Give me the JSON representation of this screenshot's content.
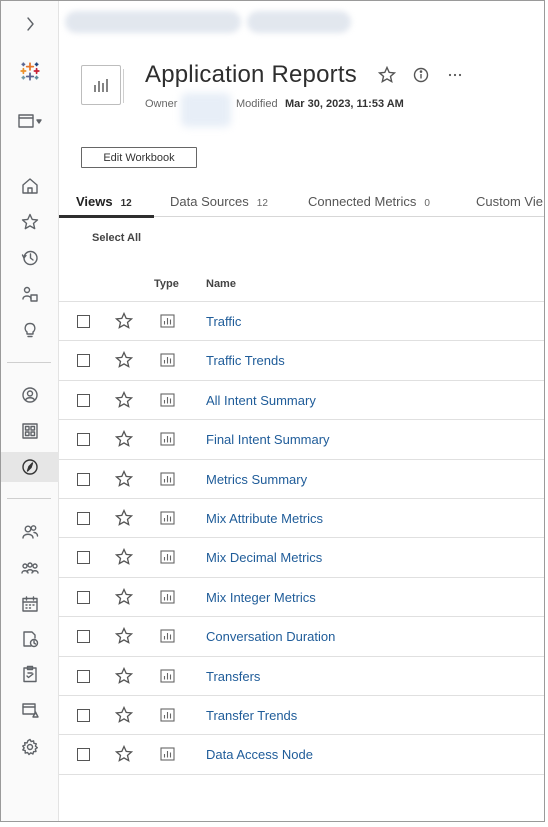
{
  "header": {
    "title": "Application Reports",
    "owner_label": "Owner",
    "modified_label": "Modified",
    "modified_value": "Mar 30, 2023, 11:53 AM",
    "edit_button": "Edit Workbook"
  },
  "tabs": [
    {
      "label": "Views",
      "count": "12",
      "active": true
    },
    {
      "label": "Data Sources",
      "count": "12",
      "active": false
    },
    {
      "label": "Connected Metrics",
      "count": "0",
      "active": false
    },
    {
      "label": "Custom Vie",
      "count": "",
      "active": false
    }
  ],
  "toolbar": {
    "select_all": "Select All"
  },
  "table": {
    "columns": {
      "type": "Type",
      "name": "Name"
    },
    "rows": [
      "Traffic",
      "Traffic Trends",
      "All Intent Summary",
      "Final Intent Summary",
      "Metrics Summary",
      "Mix Attribute Metrics",
      "Mix Decimal Metrics",
      "Mix Integer Metrics",
      "Conversation Duration",
      "Transfers",
      "Transfer Trends",
      "Data Access Node"
    ]
  },
  "rail_icons": [
    "expand-chevron-icon",
    "tableau-logo-icon",
    "site-menu-icon",
    "home-icon",
    "favorites-star-icon",
    "recents-clock-icon",
    "shared-with-me-icon",
    "recommendations-bulb-icon",
    "personal-space-icon",
    "collections-icon",
    "explore-compass-icon",
    "users-icon",
    "groups-icon",
    "schedules-icon",
    "tasks-icon",
    "jobs-icon",
    "data-connections-icon",
    "settings-gear-icon"
  ],
  "colors": {
    "link": "#1f5c99",
    "accent": "#2e2e2e"
  }
}
